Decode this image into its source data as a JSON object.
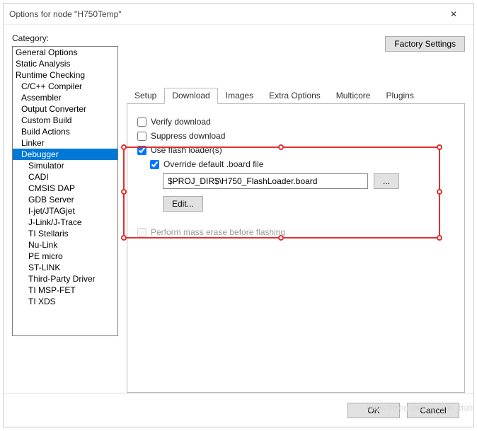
{
  "window": {
    "title": "Options for node \"H750Temp\"",
    "close_glyph": "✕"
  },
  "category": {
    "label": "Category:",
    "items": [
      {
        "label": "General Options",
        "indent": 0,
        "selected": false
      },
      {
        "label": "Static Analysis",
        "indent": 0,
        "selected": false
      },
      {
        "label": "Runtime Checking",
        "indent": 0,
        "selected": false
      },
      {
        "label": "C/C++ Compiler",
        "indent": 1,
        "selected": false
      },
      {
        "label": "Assembler",
        "indent": 1,
        "selected": false
      },
      {
        "label": "Output Converter",
        "indent": 1,
        "selected": false
      },
      {
        "label": "Custom Build",
        "indent": 1,
        "selected": false
      },
      {
        "label": "Build Actions",
        "indent": 1,
        "selected": false
      },
      {
        "label": "Linker",
        "indent": 1,
        "selected": false
      },
      {
        "label": "Debugger",
        "indent": 1,
        "selected": true
      },
      {
        "label": "Simulator",
        "indent": 2,
        "selected": false
      },
      {
        "label": "CADI",
        "indent": 2,
        "selected": false
      },
      {
        "label": "CMSIS DAP",
        "indent": 2,
        "selected": false
      },
      {
        "label": "GDB Server",
        "indent": 2,
        "selected": false
      },
      {
        "label": "I-jet/JTAGjet",
        "indent": 2,
        "selected": false
      },
      {
        "label": "J-Link/J-Trace",
        "indent": 2,
        "selected": false
      },
      {
        "label": "TI Stellaris",
        "indent": 2,
        "selected": false
      },
      {
        "label": "Nu-Link",
        "indent": 2,
        "selected": false
      },
      {
        "label": "PE micro",
        "indent": 2,
        "selected": false
      },
      {
        "label": "ST-LINK",
        "indent": 2,
        "selected": false
      },
      {
        "label": "Third-Party Driver",
        "indent": 2,
        "selected": false
      },
      {
        "label": "TI MSP-FET",
        "indent": 2,
        "selected": false
      },
      {
        "label": "TI XDS",
        "indent": 2,
        "selected": false
      }
    ]
  },
  "factory_settings_label": "Factory Settings",
  "tabs": [
    {
      "label": "Setup",
      "active": false
    },
    {
      "label": "Download",
      "active": true
    },
    {
      "label": "Images",
      "active": false
    },
    {
      "label": "Extra Options",
      "active": false
    },
    {
      "label": "Multicore",
      "active": false
    },
    {
      "label": "Plugins",
      "active": false
    }
  ],
  "download": {
    "verify_label": "Verify download",
    "verify_checked": false,
    "suppress_label": "Suppress download",
    "suppress_checked": false,
    "use_flash_label": "Use flash loader(s)",
    "use_flash_checked": true,
    "override_label": "Override default .board file",
    "override_checked": true,
    "path_value": "$PROJ_DIR$\\H750_FlashLoader.board",
    "browse_label": "...",
    "edit_label": "Edit...",
    "mass_erase_label": "Perform mass erase before flashing",
    "mass_erase_checked": false
  },
  "footer": {
    "ok_label": "OK",
    "cancel_label": "Cancel"
  },
  "watermark": "https://blog.csdn.net/lin_duo"
}
